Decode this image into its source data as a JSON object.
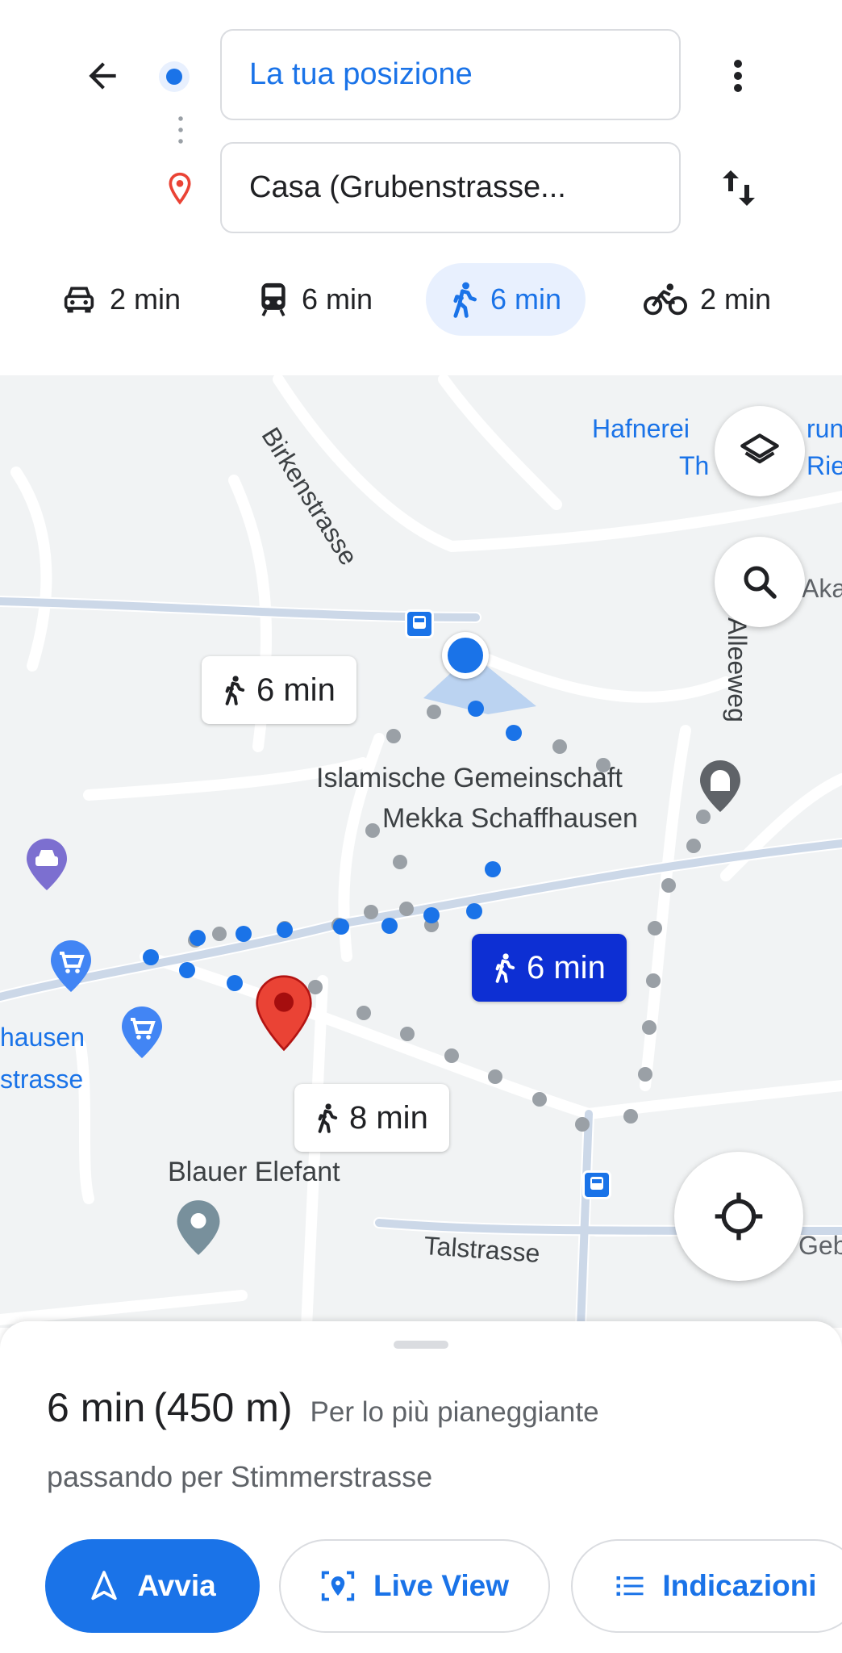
{
  "search": {
    "origin_value": "La tua posizione",
    "destination_value": "Casa (Grubenstrasse..."
  },
  "modes": [
    {
      "icon": "car-icon",
      "label": "2 min"
    },
    {
      "icon": "transit-icon",
      "label": "6 min"
    },
    {
      "icon": "walk-icon",
      "label": "6 min",
      "active": true
    },
    {
      "icon": "bike-icon",
      "label": "2 min"
    }
  ],
  "map": {
    "streets": [
      "Birkenstrasse",
      "Alleeweg",
      "Talstrasse"
    ],
    "places": {
      "hafnerei_line1": "Hafnerei",
      "hafnerei_suffix": "run",
      "hafnerei_line2": "Th",
      "hafnerei_suffix2": "Rie",
      "aka": "Aka",
      "mosque_line1": "Islamische Gemeinschaft",
      "mosque_line2": "Mekka Schaffhausen",
      "hausen": "hausen",
      "strasse": "strasse",
      "blauer": "Blauer Elefant",
      "geb": "Geb"
    },
    "route_labels": {
      "alt_1": "6 min",
      "selected": "6 min",
      "alt_2": "8 min"
    }
  },
  "colors": {
    "accent": "#1a73e8",
    "selected_route": "#0d2fd3",
    "destination_pin": "#ea4335",
    "route_gray": "#9aa0a6"
  },
  "sheet": {
    "time": "6 min",
    "distance": "(450 m)",
    "description": "Per lo più pianeggiante",
    "via": "passando per Stimmerstrasse"
  },
  "actions": {
    "start": "Avvia",
    "live_view": "Live View",
    "directions": "Indicazioni"
  }
}
